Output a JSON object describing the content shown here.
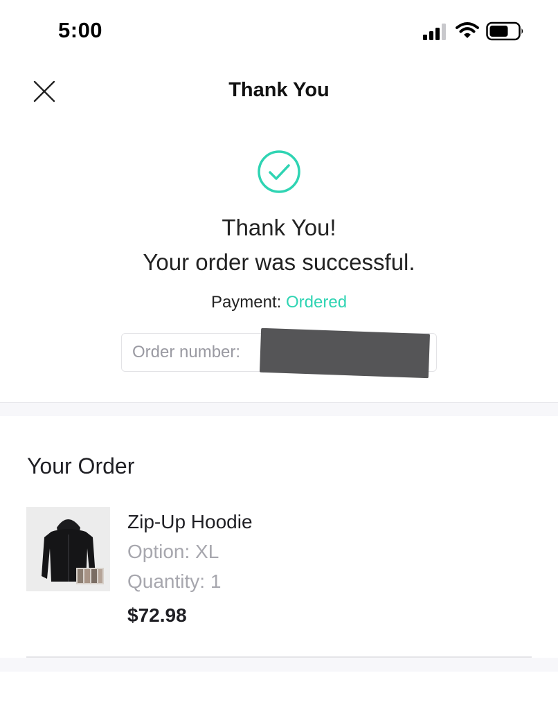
{
  "status_bar": {
    "time": "5:00",
    "icons": [
      "signal-icon",
      "wifi-icon",
      "battery-icon"
    ]
  },
  "header": {
    "title": "Thank You",
    "close_icon": "close-icon"
  },
  "confirmation": {
    "icon": "checkmark-circle-icon",
    "line1": "Thank You!",
    "line2": "Your order was successful.",
    "payment_label": "Payment:",
    "payment_status": "Ordered",
    "order_number_label": "Order number:"
  },
  "order": {
    "title": "Your Order",
    "items": [
      {
        "name": "Zip-Up Hoodie",
        "option": "Option: XL",
        "quantity": "Quantity: 1",
        "price": "$72.98"
      }
    ]
  },
  "colors": {
    "accent": "#2fd4b3",
    "text": "#1f1f24",
    "muted": "#a7a7ae",
    "divider": "#e4e4e8"
  }
}
